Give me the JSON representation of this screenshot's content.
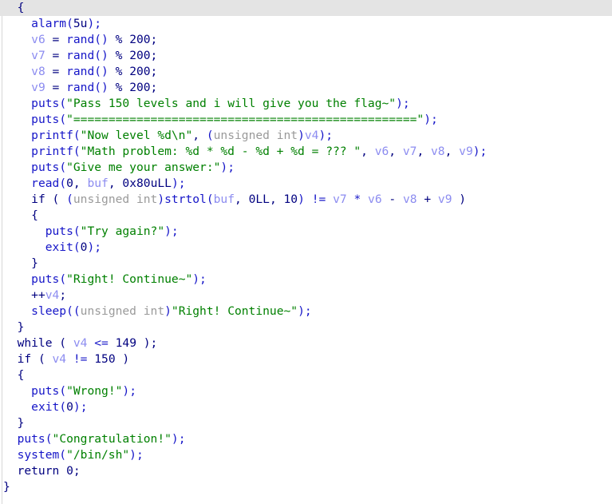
{
  "view": {
    "name": "ida-pseudocode-view",
    "background": "#ffffff",
    "highlight_color": "#e4e4e4",
    "colors": {
      "keyword": "#000080",
      "function": "#1515c8",
      "string": "#008000",
      "number": "#000080",
      "variable": "#8c8cf0",
      "type_cast": "#9a9a9a",
      "punctuation": "#1515c8"
    }
  },
  "code": {
    "language": "c-pseudocode",
    "lines": [
      {
        "indent": 1,
        "highlight": true,
        "tokens": [
          {
            "t": "plain",
            "v": "{"
          }
        ]
      },
      {
        "indent": 2,
        "highlight": false,
        "tokens": [
          {
            "t": "fn",
            "v": "alarm"
          },
          {
            "t": "punc",
            "v": "("
          },
          {
            "t": "num",
            "v": "5u"
          },
          {
            "t": "punc",
            "v": ");"
          }
        ]
      },
      {
        "indent": 2,
        "highlight": false,
        "tokens": [
          {
            "t": "var",
            "v": "v6"
          },
          {
            "t": "plain",
            "v": " = "
          },
          {
            "t": "fn",
            "v": "rand"
          },
          {
            "t": "punc",
            "v": "()"
          },
          {
            "t": "plain",
            "v": " % "
          },
          {
            "t": "num",
            "v": "200"
          },
          {
            "t": "plain",
            "v": ";"
          }
        ]
      },
      {
        "indent": 2,
        "highlight": false,
        "tokens": [
          {
            "t": "var",
            "v": "v7"
          },
          {
            "t": "plain",
            "v": " = "
          },
          {
            "t": "fn",
            "v": "rand"
          },
          {
            "t": "punc",
            "v": "()"
          },
          {
            "t": "plain",
            "v": " % "
          },
          {
            "t": "num",
            "v": "200"
          },
          {
            "t": "plain",
            "v": ";"
          }
        ]
      },
      {
        "indent": 2,
        "highlight": false,
        "tokens": [
          {
            "t": "var",
            "v": "v8"
          },
          {
            "t": "plain",
            "v": " = "
          },
          {
            "t": "fn",
            "v": "rand"
          },
          {
            "t": "punc",
            "v": "()"
          },
          {
            "t": "plain",
            "v": " % "
          },
          {
            "t": "num",
            "v": "200"
          },
          {
            "t": "plain",
            "v": ";"
          }
        ]
      },
      {
        "indent": 2,
        "highlight": false,
        "tokens": [
          {
            "t": "var",
            "v": "v9"
          },
          {
            "t": "plain",
            "v": " = "
          },
          {
            "t": "fn",
            "v": "rand"
          },
          {
            "t": "punc",
            "v": "()"
          },
          {
            "t": "plain",
            "v": " % "
          },
          {
            "t": "num",
            "v": "200"
          },
          {
            "t": "plain",
            "v": ";"
          }
        ]
      },
      {
        "indent": 2,
        "highlight": false,
        "tokens": [
          {
            "t": "fn",
            "v": "puts"
          },
          {
            "t": "punc",
            "v": "("
          },
          {
            "t": "str",
            "v": "\"Pass 150 levels and i will give you the flag~\""
          },
          {
            "t": "punc",
            "v": ");"
          }
        ]
      },
      {
        "indent": 2,
        "highlight": false,
        "tokens": [
          {
            "t": "fn",
            "v": "puts"
          },
          {
            "t": "punc",
            "v": "("
          },
          {
            "t": "str",
            "v": "\"=================================================\""
          },
          {
            "t": "punc",
            "v": ");"
          }
        ]
      },
      {
        "indent": 2,
        "highlight": false,
        "tokens": [
          {
            "t": "fn",
            "v": "printf"
          },
          {
            "t": "punc",
            "v": "("
          },
          {
            "t": "str",
            "v": "\"Now level %d\\n\""
          },
          {
            "t": "plain",
            "v": ", "
          },
          {
            "t": "punc",
            "v": "("
          },
          {
            "t": "type",
            "v": "unsigned int"
          },
          {
            "t": "punc",
            "v": ")"
          },
          {
            "t": "var",
            "v": "v4"
          },
          {
            "t": "punc",
            "v": ");"
          }
        ]
      },
      {
        "indent": 2,
        "highlight": false,
        "tokens": [
          {
            "t": "fn",
            "v": "printf"
          },
          {
            "t": "punc",
            "v": "("
          },
          {
            "t": "str",
            "v": "\"Math problem: %d * %d - %d + %d = ??? \""
          },
          {
            "t": "plain",
            "v": ", "
          },
          {
            "t": "var",
            "v": "v6"
          },
          {
            "t": "plain",
            "v": ", "
          },
          {
            "t": "var",
            "v": "v7"
          },
          {
            "t": "plain",
            "v": ", "
          },
          {
            "t": "var",
            "v": "v8"
          },
          {
            "t": "plain",
            "v": ", "
          },
          {
            "t": "var",
            "v": "v9"
          },
          {
            "t": "punc",
            "v": ");"
          }
        ]
      },
      {
        "indent": 2,
        "highlight": false,
        "tokens": [
          {
            "t": "fn",
            "v": "puts"
          },
          {
            "t": "punc",
            "v": "("
          },
          {
            "t": "str",
            "v": "\"Give me your answer:\""
          },
          {
            "t": "punc",
            "v": ");"
          }
        ]
      },
      {
        "indent": 2,
        "highlight": false,
        "tokens": [
          {
            "t": "fn",
            "v": "read"
          },
          {
            "t": "punc",
            "v": "("
          },
          {
            "t": "num",
            "v": "0"
          },
          {
            "t": "plain",
            "v": ", "
          },
          {
            "t": "var",
            "v": "buf"
          },
          {
            "t": "plain",
            "v": ", "
          },
          {
            "t": "num",
            "v": "0x80uLL"
          },
          {
            "t": "punc",
            "v": ");"
          }
        ]
      },
      {
        "indent": 2,
        "highlight": false,
        "tokens": [
          {
            "t": "kw",
            "v": "if"
          },
          {
            "t": "plain",
            "v": " ( "
          },
          {
            "t": "punc",
            "v": "("
          },
          {
            "t": "type",
            "v": "unsigned int"
          },
          {
            "t": "punc",
            "v": ")"
          },
          {
            "t": "fn",
            "v": "strtol"
          },
          {
            "t": "punc",
            "v": "("
          },
          {
            "t": "var",
            "v": "buf"
          },
          {
            "t": "plain",
            "v": ", "
          },
          {
            "t": "num",
            "v": "0LL"
          },
          {
            "t": "plain",
            "v": ", "
          },
          {
            "t": "num",
            "v": "10"
          },
          {
            "t": "punc",
            "v": ")"
          },
          {
            "t": "plain",
            "v": " "
          },
          {
            "t": "punc",
            "v": "!="
          },
          {
            "t": "plain",
            "v": " "
          },
          {
            "t": "var",
            "v": "v7"
          },
          {
            "t": "plain",
            "v": " "
          },
          {
            "t": "punc",
            "v": "*"
          },
          {
            "t": "plain",
            "v": " "
          },
          {
            "t": "var",
            "v": "v6"
          },
          {
            "t": "plain",
            "v": " - "
          },
          {
            "t": "var",
            "v": "v8"
          },
          {
            "t": "plain",
            "v": " + "
          },
          {
            "t": "var",
            "v": "v9"
          },
          {
            "t": "plain",
            "v": " )"
          }
        ]
      },
      {
        "indent": 2,
        "highlight": false,
        "tokens": [
          {
            "t": "plain",
            "v": "{"
          }
        ]
      },
      {
        "indent": 3,
        "highlight": false,
        "tokens": [
          {
            "t": "fn",
            "v": "puts"
          },
          {
            "t": "punc",
            "v": "("
          },
          {
            "t": "str",
            "v": "\"Try again?\""
          },
          {
            "t": "punc",
            "v": ");"
          }
        ]
      },
      {
        "indent": 3,
        "highlight": false,
        "tokens": [
          {
            "t": "fn",
            "v": "exit"
          },
          {
            "t": "punc",
            "v": "("
          },
          {
            "t": "num",
            "v": "0"
          },
          {
            "t": "punc",
            "v": ");"
          }
        ]
      },
      {
        "indent": 2,
        "highlight": false,
        "tokens": [
          {
            "t": "plain",
            "v": "}"
          }
        ]
      },
      {
        "indent": 2,
        "highlight": false,
        "tokens": [
          {
            "t": "fn",
            "v": "puts"
          },
          {
            "t": "punc",
            "v": "("
          },
          {
            "t": "str",
            "v": "\"Right! Continue~\""
          },
          {
            "t": "punc",
            "v": ");"
          }
        ]
      },
      {
        "indent": 2,
        "highlight": false,
        "tokens": [
          {
            "t": "plain",
            "v": "++"
          },
          {
            "t": "var",
            "v": "v4"
          },
          {
            "t": "plain",
            "v": ";"
          }
        ]
      },
      {
        "indent": 2,
        "highlight": false,
        "tokens": [
          {
            "t": "fn",
            "v": "sleep"
          },
          {
            "t": "punc",
            "v": "(("
          },
          {
            "t": "type",
            "v": "unsigned int"
          },
          {
            "t": "punc",
            "v": ")"
          },
          {
            "t": "str",
            "v": "\"Right! Continue~\""
          },
          {
            "t": "punc",
            "v": ");"
          }
        ]
      },
      {
        "indent": 1,
        "highlight": false,
        "tokens": [
          {
            "t": "plain",
            "v": "}"
          }
        ]
      },
      {
        "indent": 1,
        "highlight": false,
        "tokens": [
          {
            "t": "kw",
            "v": "while"
          },
          {
            "t": "plain",
            "v": " ( "
          },
          {
            "t": "var",
            "v": "v4"
          },
          {
            "t": "plain",
            "v": " "
          },
          {
            "t": "punc",
            "v": "<="
          },
          {
            "t": "plain",
            "v": " "
          },
          {
            "t": "num",
            "v": "149"
          },
          {
            "t": "plain",
            "v": " );"
          }
        ]
      },
      {
        "indent": 1,
        "highlight": false,
        "tokens": [
          {
            "t": "kw",
            "v": "if"
          },
          {
            "t": "plain",
            "v": " ( "
          },
          {
            "t": "var",
            "v": "v4"
          },
          {
            "t": "plain",
            "v": " "
          },
          {
            "t": "punc",
            "v": "!="
          },
          {
            "t": "plain",
            "v": " "
          },
          {
            "t": "num",
            "v": "150"
          },
          {
            "t": "plain",
            "v": " )"
          }
        ]
      },
      {
        "indent": 1,
        "highlight": false,
        "tokens": [
          {
            "t": "plain",
            "v": "{"
          }
        ]
      },
      {
        "indent": 2,
        "highlight": false,
        "tokens": [
          {
            "t": "fn",
            "v": "puts"
          },
          {
            "t": "punc",
            "v": "("
          },
          {
            "t": "str",
            "v": "\"Wrong!\""
          },
          {
            "t": "punc",
            "v": ");"
          }
        ]
      },
      {
        "indent": 2,
        "highlight": false,
        "tokens": [
          {
            "t": "fn",
            "v": "exit"
          },
          {
            "t": "punc",
            "v": "("
          },
          {
            "t": "num",
            "v": "0"
          },
          {
            "t": "punc",
            "v": ");"
          }
        ]
      },
      {
        "indent": 1,
        "highlight": false,
        "tokens": [
          {
            "t": "plain",
            "v": "}"
          }
        ]
      },
      {
        "indent": 1,
        "highlight": false,
        "tokens": [
          {
            "t": "fn",
            "v": "puts"
          },
          {
            "t": "punc",
            "v": "("
          },
          {
            "t": "str",
            "v": "\"Congratulation!\""
          },
          {
            "t": "punc",
            "v": ");"
          }
        ]
      },
      {
        "indent": 1,
        "highlight": false,
        "tokens": [
          {
            "t": "fn",
            "v": "system"
          },
          {
            "t": "punc",
            "v": "("
          },
          {
            "t": "str",
            "v": "\"/bin/sh\""
          },
          {
            "t": "punc",
            "v": ");"
          }
        ]
      },
      {
        "indent": 1,
        "highlight": false,
        "tokens": [
          {
            "t": "kw",
            "v": "return"
          },
          {
            "t": "plain",
            "v": " "
          },
          {
            "t": "num",
            "v": "0"
          },
          {
            "t": "plain",
            "v": ";"
          }
        ]
      },
      {
        "indent": 0,
        "highlight": false,
        "tokens": [
          {
            "t": "plain",
            "v": "}"
          }
        ]
      }
    ]
  }
}
